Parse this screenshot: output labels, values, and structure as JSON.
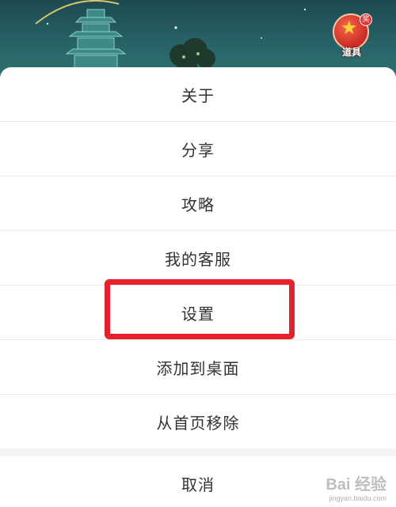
{
  "background": {
    "prop_badge_label": "道具",
    "prop_badge_tag": "奖"
  },
  "menu": {
    "items": [
      {
        "label": "关于"
      },
      {
        "label": "分享"
      },
      {
        "label": "攻略"
      },
      {
        "label": "我的客服"
      },
      {
        "label": "设置"
      },
      {
        "label": "添加到桌面"
      },
      {
        "label": "从首页移除"
      }
    ],
    "cancel_label": "取消",
    "highlighted_item": "设置"
  },
  "watermark": {
    "brand": "Bai 经验",
    "url": "jingyan.baidu.com"
  },
  "colors": {
    "highlight": "#e8202a",
    "scene": "#2a6a6c",
    "text": "#333333"
  }
}
